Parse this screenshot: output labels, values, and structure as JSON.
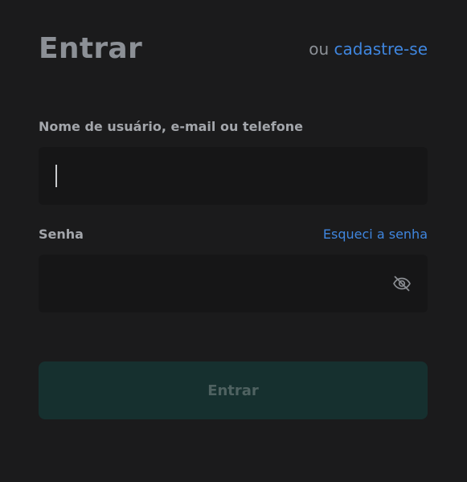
{
  "header": {
    "title": "Entrar",
    "or_text": "ou",
    "signup_link": "cadastre-se"
  },
  "username": {
    "label": "Nome de usuário, e-mail ou telefone",
    "value": "",
    "placeholder": ""
  },
  "password": {
    "label": "Senha",
    "forgot_link": "Esqueci a senha",
    "value": "",
    "placeholder": "",
    "toggle_icon": "eye-off-icon"
  },
  "submit": {
    "label": "Entrar"
  },
  "colors": {
    "background": "#1b1b1c",
    "input_background": "#161617",
    "link": "#3f86df",
    "title": "#8c9096",
    "label": "#a3a6ab",
    "button_background": "#16302f",
    "button_text": "#4f6261"
  }
}
